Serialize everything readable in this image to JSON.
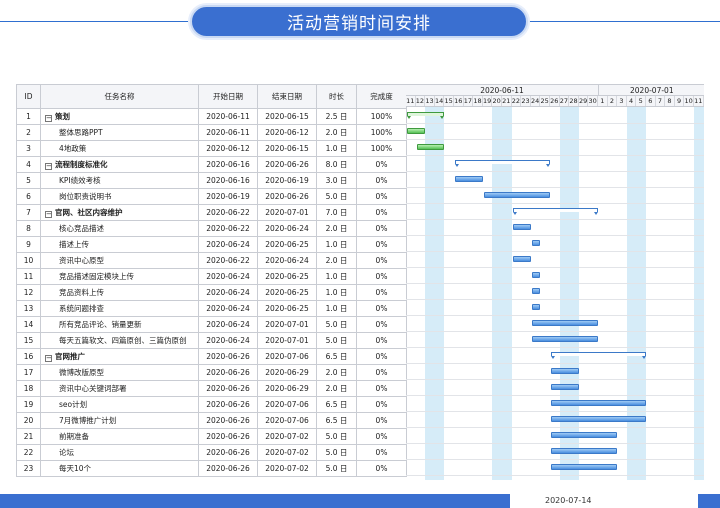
{
  "header": {
    "title": "活动营销时间安排"
  },
  "columns": {
    "id": "ID",
    "name": "任务名称",
    "start": "开始日期",
    "end": "结束日期",
    "duration": "时长",
    "progress": "完成度"
  },
  "timeline": {
    "months": [
      "2020-06-11",
      "2020-07-01"
    ],
    "days": [
      "11",
      "12",
      "13",
      "14",
      "15",
      "16",
      "17",
      "18",
      "19",
      "20",
      "21",
      "22",
      "23",
      "24",
      "25",
      "26",
      "27",
      "28",
      "29",
      "30",
      "1",
      "2",
      "3",
      "4",
      "5",
      "6",
      "7",
      "8",
      "9",
      "10",
      "11"
    ],
    "weekend_day_indices": [
      2,
      3,
      9,
      10,
      16,
      17,
      23,
      24,
      30
    ]
  },
  "colors": {
    "accent": "#3a6fd0",
    "task_bar": "#4a8ee0",
    "done_bar": "#55c155",
    "weekend": "#d6ecf8"
  },
  "tasks": [
    {
      "id": "1",
      "name": "策划",
      "start": "2020-06-11",
      "end": "2020-06-15",
      "duration": "2.5 日",
      "progress": "100%",
      "summary": true,
      "level": 0,
      "s": 0,
      "e": 4,
      "done": true
    },
    {
      "id": "2",
      "name": "整体思路PPT",
      "start": "2020-06-11",
      "end": "2020-06-12",
      "duration": "2.0 日",
      "progress": "100%",
      "summary": false,
      "level": 1,
      "s": 0,
      "e": 2,
      "done": true
    },
    {
      "id": "3",
      "name": "4地政策",
      "start": "2020-06-12",
      "end": "2020-06-15",
      "duration": "1.0 日",
      "progress": "100%",
      "summary": false,
      "level": 1,
      "s": 1,
      "e": 4,
      "done": true
    },
    {
      "id": "4",
      "name": "流程制度标准化",
      "start": "2020-06-16",
      "end": "2020-06-26",
      "duration": "8.0 日",
      "progress": "0%",
      "summary": true,
      "level": 0,
      "s": 5,
      "e": 15,
      "done": false
    },
    {
      "id": "5",
      "name": "KPI绩效考核",
      "start": "2020-06-16",
      "end": "2020-06-19",
      "duration": "3.0 日",
      "progress": "0%",
      "summary": false,
      "level": 1,
      "s": 5,
      "e": 8,
      "done": false
    },
    {
      "id": "6",
      "name": "岗位职责说明书",
      "start": "2020-06-19",
      "end": "2020-06-26",
      "duration": "5.0 日",
      "progress": "0%",
      "summary": false,
      "level": 1,
      "s": 8,
      "e": 15,
      "done": false
    },
    {
      "id": "7",
      "name": "官网、社区内容维护",
      "start": "2020-06-22",
      "end": "2020-07-01",
      "duration": "7.0 日",
      "progress": "0%",
      "summary": true,
      "level": 0,
      "s": 11,
      "e": 20,
      "done": false
    },
    {
      "id": "8",
      "name": "核心竞品描述",
      "start": "2020-06-22",
      "end": "2020-06-24",
      "duration": "2.0 日",
      "progress": "0%",
      "summary": false,
      "level": 1,
      "s": 11,
      "e": 13,
      "done": false
    },
    {
      "id": "9",
      "name": "描述上传",
      "start": "2020-06-24",
      "end": "2020-06-25",
      "duration": "1.0 日",
      "progress": "0%",
      "summary": false,
      "level": 1,
      "s": 13,
      "e": 14,
      "done": false
    },
    {
      "id": "10",
      "name": "资讯中心原型",
      "start": "2020-06-22",
      "end": "2020-06-24",
      "duration": "2.0 日",
      "progress": "0%",
      "summary": false,
      "level": 1,
      "s": 11,
      "e": 13,
      "done": false
    },
    {
      "id": "11",
      "name": "竞品描述固定模块上传",
      "start": "2020-06-24",
      "end": "2020-06-25",
      "duration": "1.0 日",
      "progress": "0%",
      "summary": false,
      "level": 1,
      "s": 13,
      "e": 14,
      "done": false
    },
    {
      "id": "12",
      "name": "竞品资料上传",
      "start": "2020-06-24",
      "end": "2020-06-25",
      "duration": "1.0 日",
      "progress": "0%",
      "summary": false,
      "level": 1,
      "s": 13,
      "e": 14,
      "done": false
    },
    {
      "id": "13",
      "name": "系统问题排查",
      "start": "2020-06-24",
      "end": "2020-06-25",
      "duration": "1.0 日",
      "progress": "0%",
      "summary": false,
      "level": 1,
      "s": 13,
      "e": 14,
      "done": false
    },
    {
      "id": "14",
      "name": "所有竞品评论、销量更新",
      "start": "2020-06-24",
      "end": "2020-07-01",
      "duration": "5.0 日",
      "progress": "0%",
      "summary": false,
      "level": 1,
      "s": 13,
      "e": 20,
      "done": false
    },
    {
      "id": "15",
      "name": "每天五篇软文、四篇原创、三篇伪原创",
      "start": "2020-06-24",
      "end": "2020-07-01",
      "duration": "5.0 日",
      "progress": "0%",
      "summary": false,
      "level": 1,
      "s": 13,
      "e": 20,
      "done": false
    },
    {
      "id": "16",
      "name": "官网推广",
      "start": "2020-06-26",
      "end": "2020-07-06",
      "duration": "6.5 日",
      "progress": "0%",
      "summary": true,
      "level": 0,
      "s": 15,
      "e": 25,
      "done": false
    },
    {
      "id": "17",
      "name": "微博改版原型",
      "start": "2020-06-26",
      "end": "2020-06-29",
      "duration": "2.0 日",
      "progress": "0%",
      "summary": false,
      "level": 1,
      "s": 15,
      "e": 18,
      "done": false
    },
    {
      "id": "18",
      "name": "资讯中心关键词部署",
      "start": "2020-06-26",
      "end": "2020-06-29",
      "duration": "2.0 日",
      "progress": "0%",
      "summary": false,
      "level": 1,
      "s": 15,
      "e": 18,
      "done": false
    },
    {
      "id": "19",
      "name": "seo计划",
      "start": "2020-06-26",
      "end": "2020-07-06",
      "duration": "6.5 日",
      "progress": "0%",
      "summary": false,
      "level": 1,
      "s": 15,
      "e": 25,
      "done": false
    },
    {
      "id": "20",
      "name": "7月微博推广计划",
      "start": "2020-06-26",
      "end": "2020-07-06",
      "duration": "6.5 日",
      "progress": "0%",
      "summary": false,
      "level": 1,
      "s": 15,
      "e": 25,
      "done": false
    },
    {
      "id": "21",
      "name": "前期准备",
      "start": "2020-06-26",
      "end": "2020-07-02",
      "duration": "5.0 日",
      "progress": "0%",
      "summary": false,
      "level": 1,
      "s": 15,
      "e": 22,
      "done": false
    },
    {
      "id": "22",
      "name": "论坛",
      "start": "2020-06-26",
      "end": "2020-07-02",
      "duration": "5.0 日",
      "progress": "0%",
      "summary": false,
      "level": 1,
      "s": 15,
      "e": 22,
      "done": false
    },
    {
      "id": "23",
      "name": "每天10个",
      "start": "2020-06-26",
      "end": "2020-07-02",
      "duration": "5.0 日",
      "progress": "0%",
      "summary": false,
      "level": 1,
      "s": 15,
      "e": 22,
      "done": false
    }
  ],
  "footer": {
    "date": "2020-07-14"
  }
}
